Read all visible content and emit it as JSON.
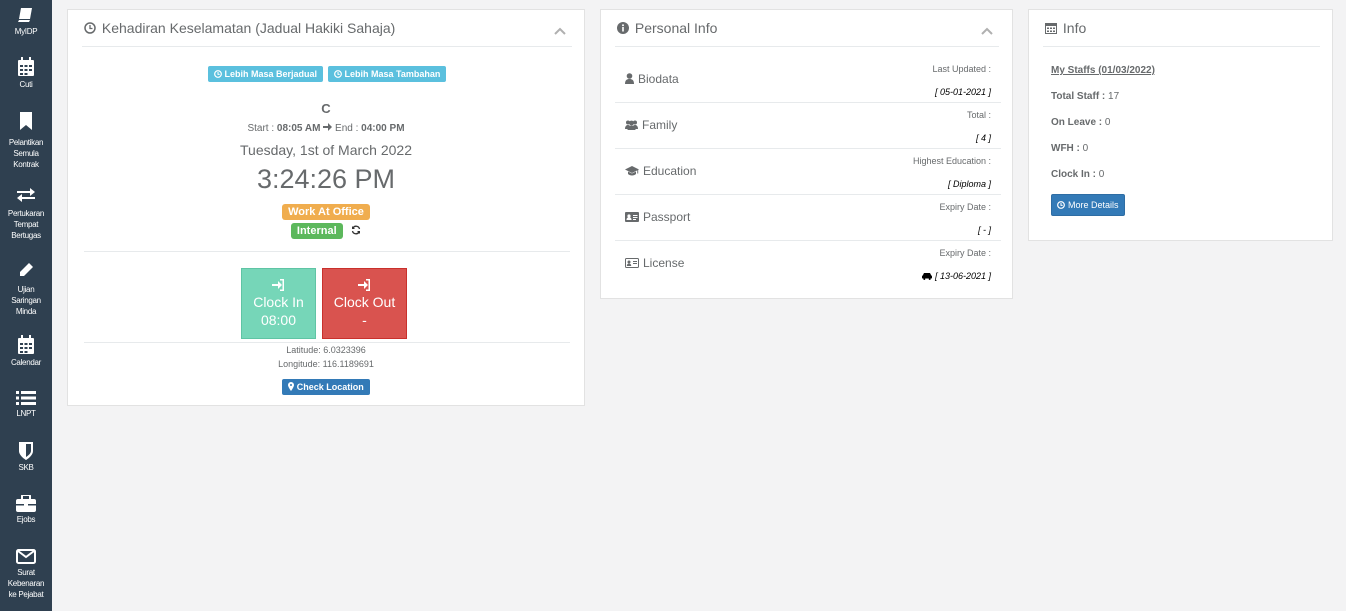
{
  "sidebar": {
    "items": [
      {
        "label": "MyIDP"
      },
      {
        "label": "Cuti"
      },
      {
        "label_lines": [
          "Pelantikan",
          "Semula",
          "Kontrak"
        ]
      },
      {
        "label_lines": [
          "Pertukaran",
          "Tempat",
          "Bertugas"
        ]
      },
      {
        "label_lines": [
          "Ujian",
          "Saringan",
          "Minda"
        ]
      },
      {
        "label": "Calendar"
      },
      {
        "label": "LNPT"
      },
      {
        "label": "SKB"
      },
      {
        "label": "Ejobs"
      },
      {
        "label_lines": [
          "Surat",
          "Kebenaran",
          "ke Pejabat"
        ]
      }
    ]
  },
  "attendance": {
    "title": "Kehadiran Keselamatan (Jadual Hakiki Sahaja)",
    "btn_scheduled": "Lebih Masa Berjadual",
    "btn_additional": "Lebih Masa Tambahan",
    "shift_code": "C",
    "start_label": "Start :",
    "start_time": "08:05 AM",
    "end_label": "End :",
    "end_time": "04:00 PM",
    "date": "Tuesday, 1st of March 2022",
    "time": "3:24:26 PM",
    "work_mode": "Work At Office",
    "network": "Internal",
    "clock_in_label": "Clock In",
    "clock_in_value": "08:00",
    "clock_out_label": "Clock Out",
    "clock_out_value": "-",
    "latitude_text": "Latitude: 6.0323396",
    "longitude_text": "Longitude: 116.1189691",
    "check_location": "Check Location",
    "colors": {
      "work_mode": "#f0ad4e",
      "network": "#5cb85c",
      "clock_in": "#76d6b8",
      "clock_out": "#d9534f"
    }
  },
  "personal": {
    "title": "Personal Info",
    "rows": [
      {
        "label": "Biodata",
        "meta": "Last Updated :",
        "value": "[ 05-01-2021 ]",
        "icon": "user-icon"
      },
      {
        "label": "Family",
        "meta": "Total :",
        "value": "[ 4 ]",
        "icon": "users-icon"
      },
      {
        "label": "Education",
        "meta": "Highest Education :",
        "value": "[ Diploma ]",
        "icon": "graduation-cap-icon"
      },
      {
        "label": "Passport",
        "meta": "Expiry Date :",
        "value": "[ - ]",
        "icon": "id-card-icon"
      },
      {
        "label": "License",
        "meta": "Expiry Date :",
        "value": "[ 13-06-2021 ]",
        "icon": "id-card-icon"
      }
    ]
  },
  "info": {
    "title": "Info",
    "my_staffs": "My Staffs (01/03/2022)",
    "total_staff_label": "Total Staff :",
    "total_staff": "17",
    "on_leave_label": "On Leave :",
    "on_leave": "0",
    "wfh_label": "WFH :",
    "wfh": "0",
    "clock_in_label": "Clock In :",
    "clock_in": "0",
    "more_details": "More Details"
  }
}
